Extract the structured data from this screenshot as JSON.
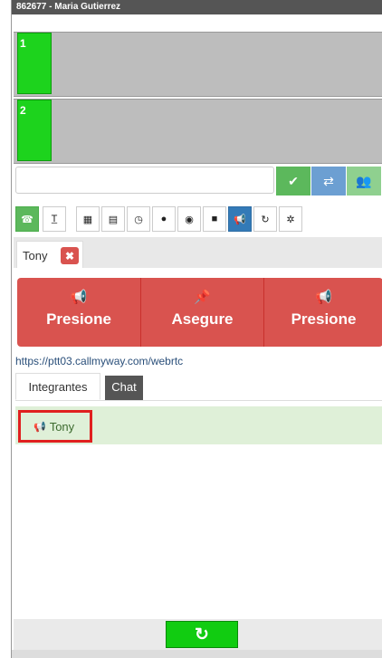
{
  "title": "862677 - Maria Gutierrez",
  "lines": [
    {
      "label": "1"
    },
    {
      "label": "2"
    }
  ],
  "input": {
    "value": "",
    "placeholder": ""
  },
  "input_buttons": [
    {
      "icon": "check-icon",
      "glyph": "✔",
      "color": "#5cb85c"
    },
    {
      "icon": "transfer-icon",
      "glyph": "⇄",
      "color": "#6c9fd2"
    },
    {
      "icon": "group-icon",
      "glyph": "👥",
      "color": "#8fd08f"
    }
  ],
  "toolbar": [
    {
      "icon": "phone-icon",
      "glyph": "☎",
      "active": "green"
    },
    {
      "icon": "text-icon",
      "glyph": "T̲",
      "active": ""
    },
    {
      "icon": "keypad-icon",
      "glyph": "▦",
      "active": ""
    },
    {
      "icon": "list-icon",
      "glyph": "▤",
      "active": ""
    },
    {
      "icon": "clock-icon",
      "glyph": "◷",
      "active": ""
    },
    {
      "icon": "user-icon",
      "glyph": "●",
      "active": ""
    },
    {
      "icon": "globe-icon",
      "glyph": "◉",
      "active": ""
    },
    {
      "icon": "comment-icon",
      "glyph": "■",
      "active": ""
    },
    {
      "icon": "megaphone-icon",
      "glyph": "📢",
      "active": "blue"
    },
    {
      "icon": "share-icon",
      "glyph": "↻",
      "active": ""
    },
    {
      "icon": "settings-icon",
      "glyph": "✲",
      "active": ""
    }
  ],
  "session_tab": {
    "label": "Tony",
    "close": "✖"
  },
  "ptt_buttons": [
    {
      "icon": "megaphone-icon",
      "glyph": "📢",
      "label": "Presione"
    },
    {
      "icon": "pin-icon",
      "glyph": "📌",
      "label": "Asegure"
    },
    {
      "icon": "megaphone-icon",
      "glyph": "📢",
      "label": "Presione"
    }
  ],
  "url": "https://ptt03.callmyway.com/webrtc",
  "content_tabs": [
    {
      "label": "Integrantes"
    },
    {
      "label": "Chat"
    }
  ],
  "members": [
    {
      "name": "Tony",
      "icon": "megaphone-icon",
      "glyph": "📢"
    }
  ],
  "refresh": {
    "glyph": "↻"
  }
}
